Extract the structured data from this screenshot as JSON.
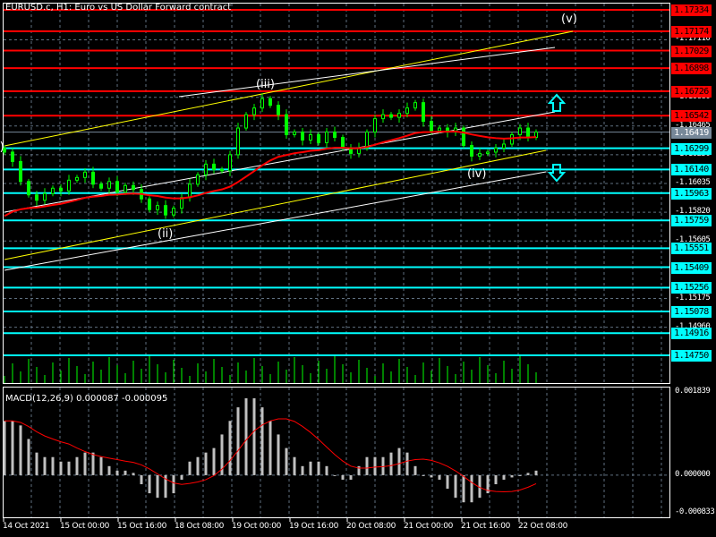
{
  "title": "EURUSD.c, H1:  Euro vs US Dollar Forward contract",
  "colors": {
    "bg": "#000000",
    "resistance": "#ff0000",
    "support": "#00ffff",
    "current": "#778899",
    "bull": "#00ff00",
    "ma": "#ff0000",
    "grid": "#5f6f7f"
  },
  "chart_data": {
    "type": "candlestick",
    "symbol": "EURUSD.c",
    "timeframe": "H1",
    "ylim": [
      1.1475,
      1.17334
    ],
    "resistance_levels": [
      "1.17334",
      "1.17174",
      "1.17029",
      "1.16898",
      "1.16726",
      "1.16542"
    ],
    "current_price": "1.16419",
    "support_levels": [
      "1.16299",
      "1.16140",
      "1.15963",
      "1.15759",
      "1.15551",
      "1.15409",
      "1.15256",
      "1.15078",
      "1.14916",
      "1.14750"
    ],
    "price_ticks": [
      "1.17110",
      "1.16680",
      "1.16465",
      "1.16250",
      "1.16035",
      "1.15820",
      "1.15605",
      "1.15175",
      "1.14960"
    ],
    "closes": [
      1.1627,
      1.162,
      1.1605,
      1.1595,
      1.1591,
      1.1596,
      1.16,
      1.1598,
      1.1606,
      1.1608,
      1.1612,
      1.1603,
      1.16,
      1.1605,
      1.1597,
      1.1602,
      1.1599,
      1.1592,
      1.1584,
      1.1587,
      1.158,
      1.1585,
      1.1593,
      1.1603,
      1.161,
      1.1618,
      1.1614,
      1.1613,
      1.1625,
      1.1645,
      1.1655,
      1.166,
      1.1667,
      1.1662,
      1.1655,
      1.164,
      1.1642,
      1.1636,
      1.164,
      1.1634,
      1.1642,
      1.1638,
      1.163,
      1.1626,
      1.163,
      1.1642,
      1.1652,
      1.1655,
      1.1653,
      1.1656,
      1.166,
      1.1664,
      1.165,
      1.1643,
      1.1645,
      1.1642,
      1.1645,
      1.1632,
      1.1624,
      1.1626,
      1.1627,
      1.163,
      1.1633,
      1.164,
      1.1645,
      1.1638,
      1.1642
    ],
    "waves": [
      "(i)",
      "(ii)",
      "(iii)",
      "(iv)",
      "(v)"
    ],
    "time_labels": [
      "14 Oct 2021",
      "15 Oct 00:00",
      "15 Oct 16:00",
      "18 Oct 08:00",
      "19 Oct 00:00",
      "19 Oct 16:00",
      "20 Oct 08:00",
      "21 Oct 00:00",
      "21 Oct 16:00",
      "22 Oct 08:00"
    ],
    "macd": {
      "label": "MACD(12,26,9) 0.000087 -0.000095",
      "ylim": [
        -0.000833,
        0.001839
      ],
      "ticks": [
        "0.001839",
        "0.000000",
        "-0.000833"
      ],
      "histogram": [
        0.0012,
        0.0012,
        0.0011,
        0.0008,
        0.0005,
        0.0004,
        0.0004,
        0.0003,
        0.0003,
        0.0004,
        0.0005,
        0.0005,
        0.0004,
        0.0002,
        0.0001,
        0.0001,
        5e-05,
        -0.0002,
        -0.0004,
        -0.0005,
        -0.0005,
        -0.0004,
        -0.0001,
        0.0003,
        0.0004,
        0.0005,
        0.0006,
        0.0009,
        0.0012,
        0.0015,
        0.0017,
        0.0017,
        0.0015,
        0.0012,
        0.0009,
        0.0006,
        0.0004,
        0.0002,
        0.0003,
        0.0003,
        0.0002,
        0,
        -0.0001,
        -0.0001,
        0.0002,
        0.0004,
        0.0004,
        0.0004,
        0.0005,
        0.0006,
        0.0005,
        0.0002,
        0,
        -5e-05,
        -0.0001,
        -0.0003,
        -0.0005,
        -0.0006,
        -0.0006,
        -0.0005,
        -0.0004,
        -0.0002,
        -0.0001,
        -5e-05,
        0,
        5e-05,
        0.0001
      ]
    }
  }
}
